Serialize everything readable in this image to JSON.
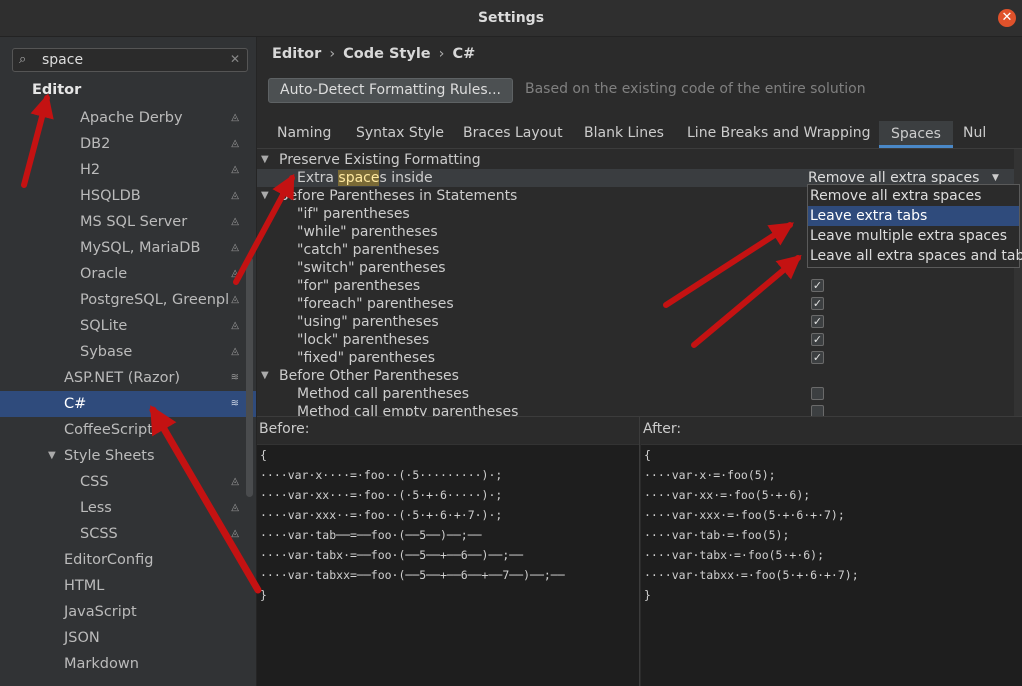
{
  "window": {
    "title": "Settings"
  },
  "search": {
    "value": "space"
  },
  "tree": {
    "root": "Editor",
    "items": [
      {
        "label": "Apache Derby"
      },
      {
        "label": "DB2"
      },
      {
        "label": "H2"
      },
      {
        "label": "HSQLDB"
      },
      {
        "label": "MS SQL Server"
      },
      {
        "label": "MySQL, MariaDB"
      },
      {
        "label": "Oracle"
      },
      {
        "label": "PostgreSQL, Greenpl"
      },
      {
        "label": "SQLite"
      },
      {
        "label": "Sybase"
      },
      {
        "label": "ASP.NET (Razor)"
      },
      {
        "label": "C#"
      },
      {
        "label": "CoffeeScript"
      },
      {
        "label": "Style Sheets"
      },
      {
        "label": "CSS"
      },
      {
        "label": "Less"
      },
      {
        "label": "SCSS"
      },
      {
        "label": "EditorConfig"
      },
      {
        "label": "HTML"
      },
      {
        "label": "JavaScript"
      },
      {
        "label": "JSON"
      },
      {
        "label": "Markdown"
      }
    ]
  },
  "breadcrumb": {
    "a": "Editor",
    "b": "Code Style",
    "c": "C#"
  },
  "autodetect": {
    "button": "Auto-Detect Formatting Rules...",
    "hint": "Based on the existing code of the entire solution"
  },
  "tabs": [
    "Naming",
    "Syntax Style",
    "Braces Layout",
    "Blank Lines",
    "Line Breaks and Wrapping",
    "Spaces",
    "Nul"
  ],
  "options": {
    "group1": "Preserve Existing Formatting",
    "extra_pre": "Extra ",
    "extra_hl": "space",
    "extra_post": "s inside",
    "combo_value": "Remove all extra spaces",
    "group2": "Before Parentheses in Statements",
    "stmt_items": [
      "\"if\" parentheses",
      "\"while\" parentheses",
      "\"catch\" parentheses",
      "\"switch\" parentheses",
      "\"for\" parentheses",
      "\"foreach\" parentheses",
      "\"using\" parentheses",
      "\"lock\" parentheses",
      "\"fixed\" parentheses"
    ],
    "group3": "Before Other Parentheses",
    "other_items": [
      "Method call parentheses",
      "Method call empty parentheses"
    ],
    "checked": "✓"
  },
  "dropdown": [
    "Remove all extra spaces",
    "Leave extra tabs",
    "Leave multiple extra spaces",
    "Leave all extra spaces and tabs"
  ],
  "preview": {
    "before_label": "Before:",
    "after_label": "After:",
    "before": [
      "{",
      "····var·x····=·foo··(·5·········)·;",
      "····var·xx···=·foo··(·5·+·6·····)·;",
      "····var·xxx··=·foo··(·5·+·6·+·7·)·;",
      "····var·tab──=──foo·(──5──)──;──",
      "····var·tabx·=──foo·(──5──+──6──)──;──",
      "····var·tabxx=──foo·(──5──+──6──+──7──)──;──",
      "}"
    ],
    "after": [
      "{",
      "····var·x·=·foo(5);",
      "····var·xx·=·foo(5·+·6);",
      "····var·xxx·=·foo(5·+·6·+·7);",
      "····var·tab·=·foo(5);",
      "····var·tabx·=·foo(5·+·6);",
      "····var·tabxx·=·foo(5·+·6·+·7);",
      "}"
    ]
  },
  "colors": {
    "accent": "#2f4b7c",
    "arrow": "#c41212",
    "close": "#e0522b"
  }
}
